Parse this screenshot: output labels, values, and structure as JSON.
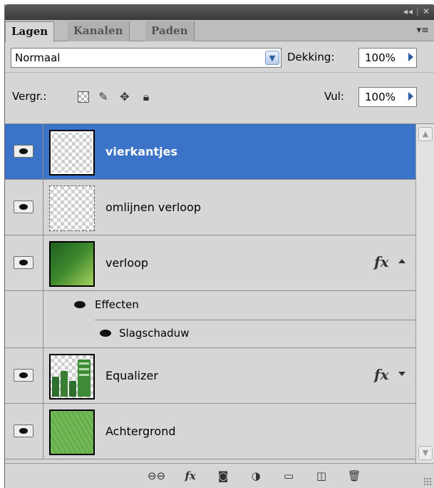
{
  "window": {
    "collapse_icon": "double-chevron-left-icon",
    "close_icon": "close-icon",
    "collapse_glyph": "◂◂",
    "close_glyph": "✕"
  },
  "tabs": [
    {
      "label": "Lagen",
      "active": true
    },
    {
      "label": "Kanalen",
      "active": false
    },
    {
      "label": "Paden",
      "active": false
    }
  ],
  "panel_menu_glyph": "▾≡",
  "blend": {
    "mode": "Normaal",
    "opacity_label": "Dekking:",
    "opacity_value": "100%"
  },
  "lock": {
    "label": "Vergr.:",
    "fill_label": "Vul:",
    "fill_value": "100%",
    "icons": [
      "lock-transparency-icon",
      "lock-image-icon",
      "lock-position-icon",
      "lock-all-icon"
    ]
  },
  "layers": [
    {
      "name": "vierkantjes",
      "selected": true,
      "thumb": "transparent",
      "fx": false
    },
    {
      "name": "omlijnen verloop",
      "selected": false,
      "thumb": "transparent",
      "fx": false
    },
    {
      "name": "verloop",
      "selected": false,
      "thumb": "green-gradient",
      "fx": true,
      "fx_label": "fx",
      "expanded": true,
      "effects_label": "Effecten",
      "effects": [
        "Slagschaduw"
      ]
    },
    {
      "name": "Equalizer",
      "selected": false,
      "thumb": "equalizer",
      "fx": true,
      "fx_label": "fx",
      "expanded": false
    },
    {
      "name": "Achtergrond",
      "selected": false,
      "thumb": "grass",
      "fx": false
    }
  ],
  "bottom_bar": {
    "icons": [
      "link-layers-icon",
      "add-layer-style-icon",
      "add-mask-icon",
      "adjustment-layer-icon",
      "new-group-icon",
      "new-layer-icon",
      "delete-layer-icon"
    ],
    "fx_label": "fx"
  },
  "colors": {
    "selection": "#3b73c8",
    "panel_bg": "#d6d6d6",
    "accent_arrow": "#2d5aa0"
  }
}
